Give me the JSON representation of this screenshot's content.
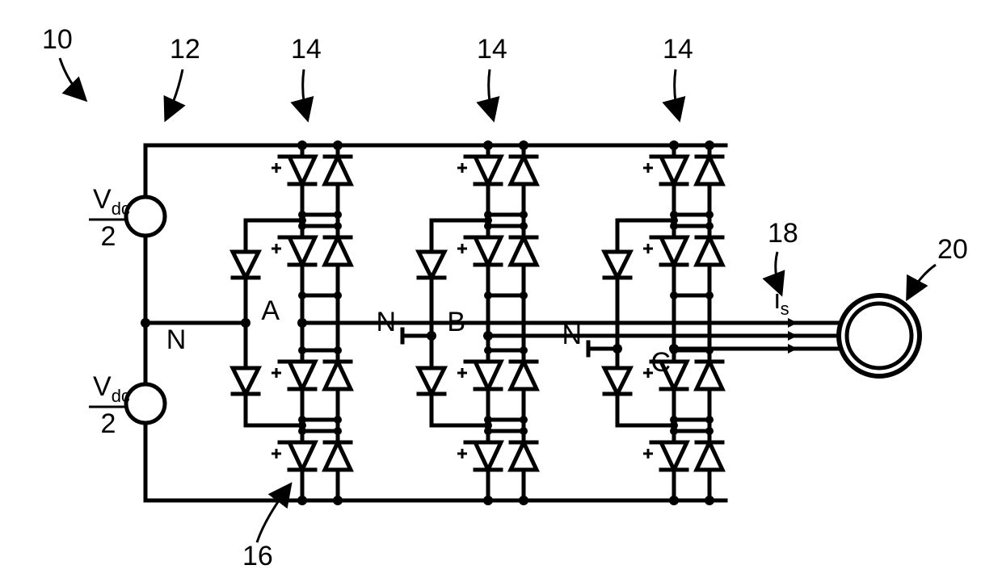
{
  "diagram": {
    "ref_numbers": {
      "system": "10",
      "dc_link": "12",
      "leg_a": "14",
      "leg_b": "14",
      "leg_c": "14",
      "switch": "16",
      "current": "18",
      "motor": "20"
    },
    "labels": {
      "vdc_top_num": "V",
      "vdc_top_sub": "dc",
      "vdc_top_den": "2",
      "vdc_bot_num": "V",
      "vdc_bot_sub": "dc",
      "vdc_bot_den": "2",
      "neutral": "N",
      "phase_a": "A",
      "phase_b": "B",
      "phase_c": "C",
      "is": "i",
      "is_sub": "s"
    }
  }
}
